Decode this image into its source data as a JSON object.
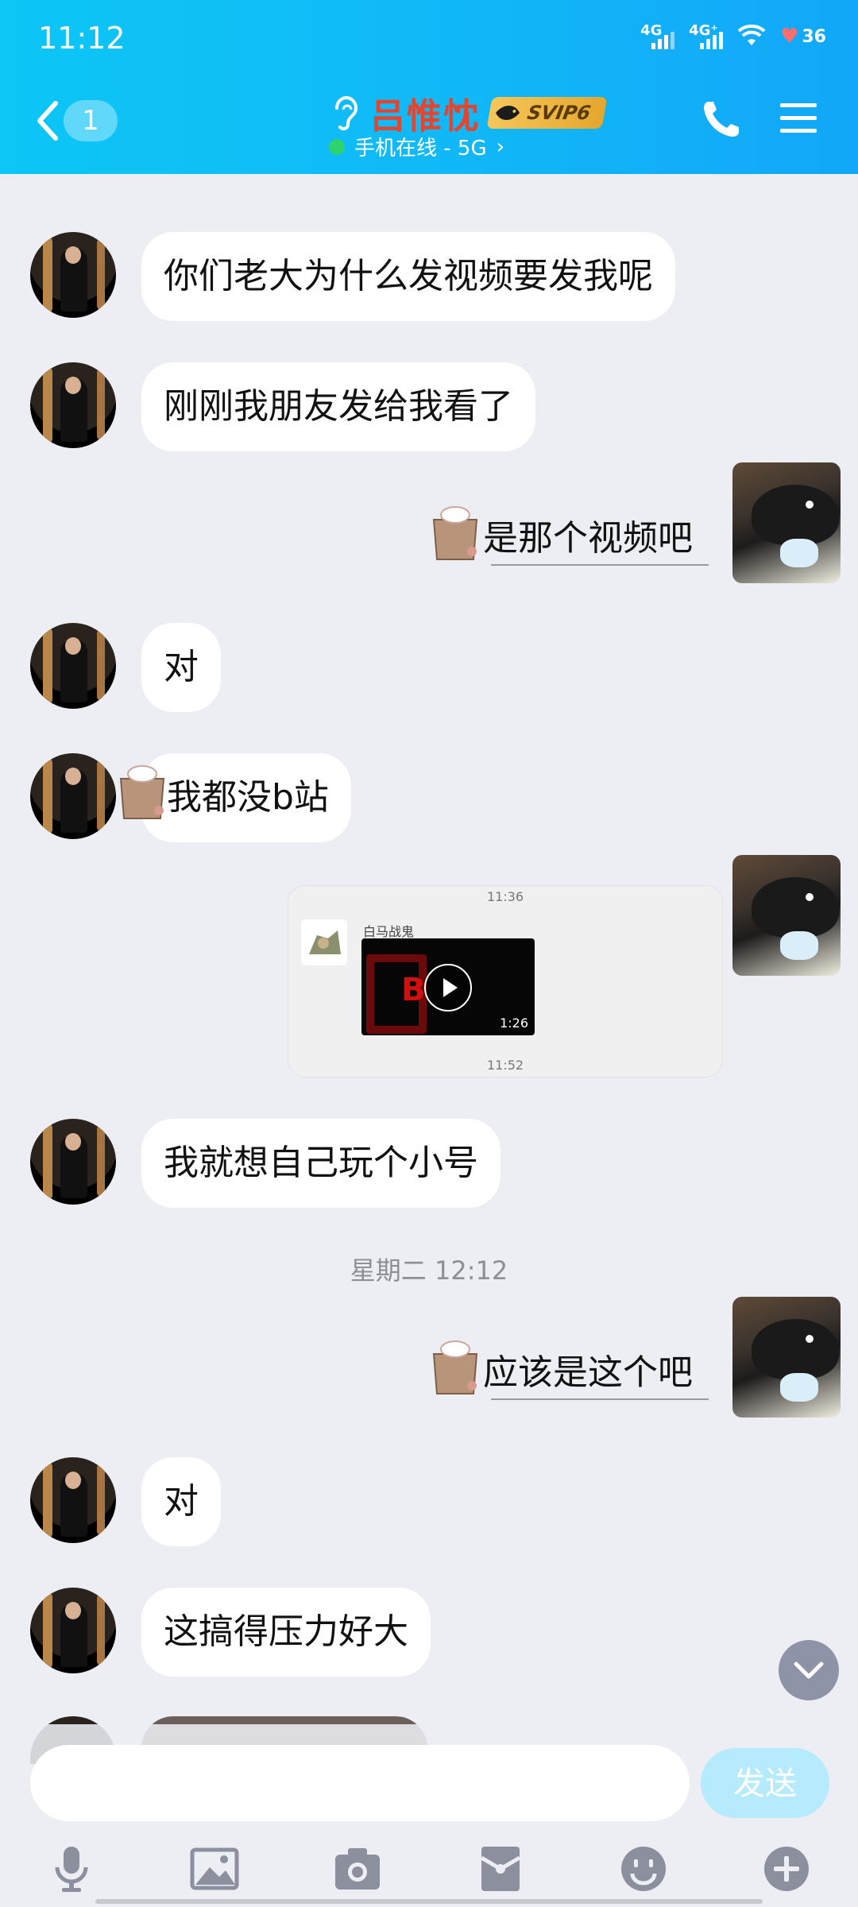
{
  "status_bar": {
    "time": "11:12",
    "signal1": "4G",
    "signal2": "4G⁺",
    "battery": "36"
  },
  "header": {
    "unread_count": "1",
    "contact_name": "吕惟忱",
    "vip_label": "SVIP6",
    "status_text": "手机在线 - 5G",
    "status_chevron": "›"
  },
  "messages": [
    {
      "side": "left",
      "text": "你们老大为什么发视频要发我呢"
    },
    {
      "side": "left",
      "text": "刚刚我朋友发给我看了"
    },
    {
      "side": "right",
      "text": "是那个视频吧"
    },
    {
      "side": "left",
      "text": "对"
    },
    {
      "side": "left",
      "text": "我都没b站"
    },
    {
      "side": "left",
      "text": "我就想自己玩个小号"
    },
    {
      "side": "right",
      "text": "应该是这个吧"
    },
    {
      "side": "left",
      "text": "对"
    },
    {
      "side": "left",
      "text": "这搞得压力好大"
    }
  ],
  "video_card": {
    "time_top": "11:36",
    "uploader": "白马战鬼",
    "duration": "1:26",
    "time_bottom": "11:52"
  },
  "date_divider": "星期二 12:12",
  "input": {
    "placeholder": "",
    "value": "",
    "send_label": "发送"
  },
  "colors": {
    "header_start": "#0cc6f6",
    "header_end": "#12a7f8",
    "name_color": "#e4452e",
    "send_button": "#b6eafd"
  },
  "icons": [
    "back-icon",
    "ear-icon",
    "phone-icon",
    "menu-icon",
    "chevron-down-icon",
    "microphone-icon",
    "image-icon",
    "camera-icon",
    "red-packet-icon",
    "emoji-icon",
    "plus-icon"
  ]
}
